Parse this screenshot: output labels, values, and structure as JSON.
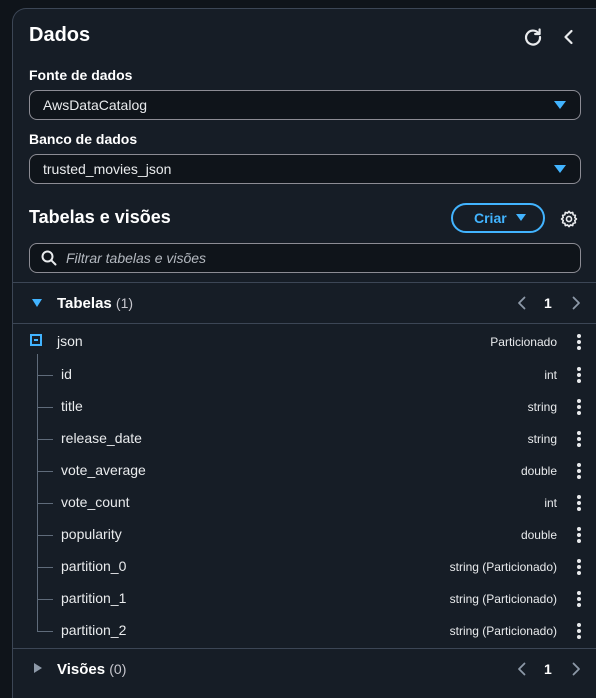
{
  "panel": {
    "title": "Dados"
  },
  "data_source": {
    "label": "Fonte de dados",
    "value": "AwsDataCatalog"
  },
  "database": {
    "label": "Banco de dados",
    "value": "trusted_movies_json"
  },
  "tables_views": {
    "title": "Tabelas e visões",
    "create_label": "Criar",
    "filter_placeholder": "Filtrar tabelas e visões"
  },
  "tables_group": {
    "label": "Tabelas",
    "count": "(1)",
    "page": "1",
    "table": {
      "name": "json",
      "type": "Particionado",
      "columns": [
        {
          "name": "id",
          "type": "int"
        },
        {
          "name": "title",
          "type": "string"
        },
        {
          "name": "release_date",
          "type": "string"
        },
        {
          "name": "vote_average",
          "type": "double"
        },
        {
          "name": "vote_count",
          "type": "int"
        },
        {
          "name": "popularity",
          "type": "double"
        },
        {
          "name": "partition_0",
          "type": "string (Particionado)"
        },
        {
          "name": "partition_1",
          "type": "string (Particionado)"
        },
        {
          "name": "partition_2",
          "type": "string (Particionado)"
        }
      ]
    }
  },
  "views_group": {
    "label": "Visões",
    "count": "(0)",
    "page": "1"
  },
  "colors": {
    "accent": "#42b4ff",
    "background": "#0f141a",
    "panel": "#161d26"
  }
}
